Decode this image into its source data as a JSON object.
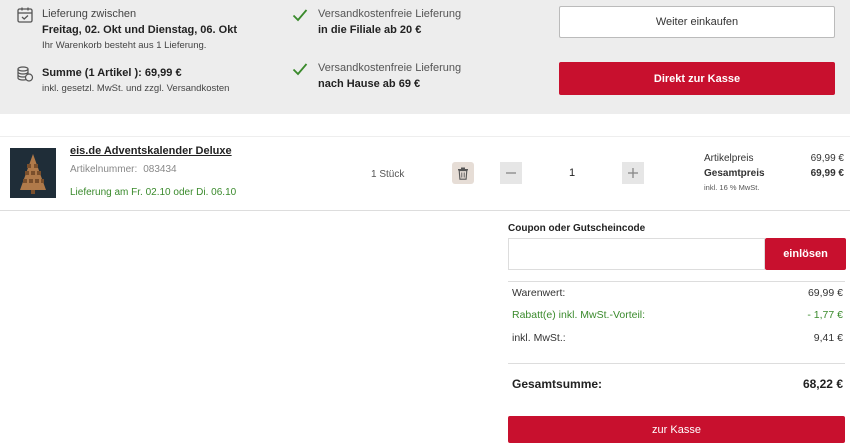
{
  "delivery": {
    "line1": "Lieferung zwischen",
    "line2": "Freitag, 02. Okt und Dienstag, 06. Okt",
    "line3": "Ihr Warenkorb besteht aus 1 Lieferung."
  },
  "sum": {
    "line1": "Summe (1 Artikel ): 69,99 €",
    "line2": "inkl. gesetzl. MwSt. und zzgl. Versandkosten"
  },
  "shipping": [
    {
      "line1": "Versandkostenfreie Lieferung",
      "line2": "in die Filiale ab 20 €"
    },
    {
      "line1": "Versandkostenfreie Lieferung",
      "line2": "nach Hause ab 69 €"
    }
  ],
  "buttons": {
    "continue_shopping": "Weiter einkaufen",
    "direct_checkout": "Direkt zur Kasse",
    "redeem": "einlösen",
    "checkout": "zur Kasse"
  },
  "item": {
    "title": "eis.de Adventskalender Deluxe",
    "article_label": "Artikelnummer:",
    "article_number": "083434",
    "delivery": "Lieferung am Fr. 02.10 oder Di. 06.10",
    "quantity_label": "1 Stück",
    "quantity_value": "1",
    "unit_price_label": "Artikelpreis",
    "unit_price": "69,99 €",
    "total_price_label": "Gesamtpreis",
    "total_price": "69,99 €",
    "tax_note": "inkl. 16 % MwSt."
  },
  "coupon": {
    "label": "Coupon oder Gutscheincode",
    "placeholder": ""
  },
  "summary": {
    "goods_label": "Warenwert:",
    "goods_value": "69,99 €",
    "discount_label": "Rabatt(e) inkl. MwSt.-Vorteil:",
    "discount_value": "- 1,77 €",
    "vat_label": "inkl. MwSt.:",
    "vat_value": "9,41 €",
    "total_label": "Gesamtsumme:",
    "total_value": "68,22 €"
  },
  "colors": {
    "brand_red": "#c8102e",
    "success_green": "#3a8a2c",
    "band_grey": "#ededed"
  }
}
